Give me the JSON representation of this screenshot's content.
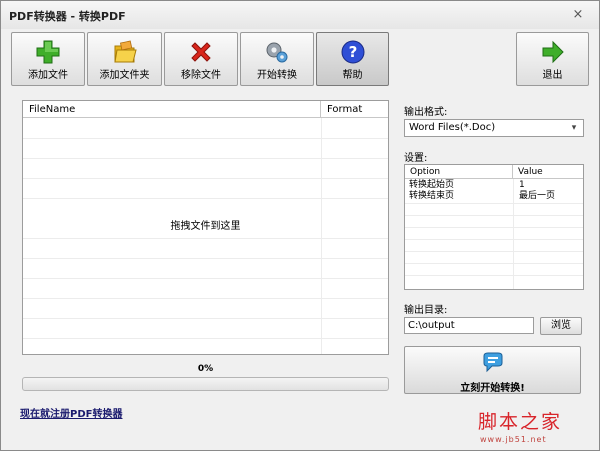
{
  "window": {
    "title": "PDF转换器 - 转换PDF",
    "close_glyph": "×"
  },
  "toolbar": {
    "buttons": [
      {
        "label": "添加文件",
        "icon": "add-file-icon"
      },
      {
        "label": "添加文件夹",
        "icon": "add-folder-icon"
      },
      {
        "label": "移除文件",
        "icon": "remove-file-icon"
      },
      {
        "label": "开始转换",
        "icon": "convert-gear-icon"
      },
      {
        "label": "帮助",
        "icon": "help-icon"
      },
      {
        "label": "退出",
        "icon": "exit-arrow-icon"
      }
    ]
  },
  "file_list": {
    "columns": [
      "FileName",
      "Format"
    ],
    "drop_hint": "拖拽文件到这里"
  },
  "progress": {
    "label": "0%",
    "value": 0
  },
  "register_link": "现在就注册PDF转换器",
  "output_format": {
    "label": "输出格式:",
    "selected": "Word Files(*.Doc)",
    "arrow": "▾"
  },
  "settings": {
    "label": "设置:",
    "columns": [
      "Option",
      "Value"
    ],
    "rows": [
      {
        "option": "转换起始页",
        "value": "1"
      },
      {
        "option": "转换结束页",
        "value": "最后一页"
      }
    ]
  },
  "output_dir": {
    "label": "输出目录:",
    "value": "C:\\output",
    "browse_label": "浏览"
  },
  "start_button": {
    "label": "立刻开始转换!"
  },
  "watermark": {
    "main": "脚本之家",
    "sub": "www.jb51.net"
  },
  "colors": {
    "watermark": "#d8242a",
    "link": "#1a1a6e",
    "help_blue": "#2f4fd6"
  }
}
